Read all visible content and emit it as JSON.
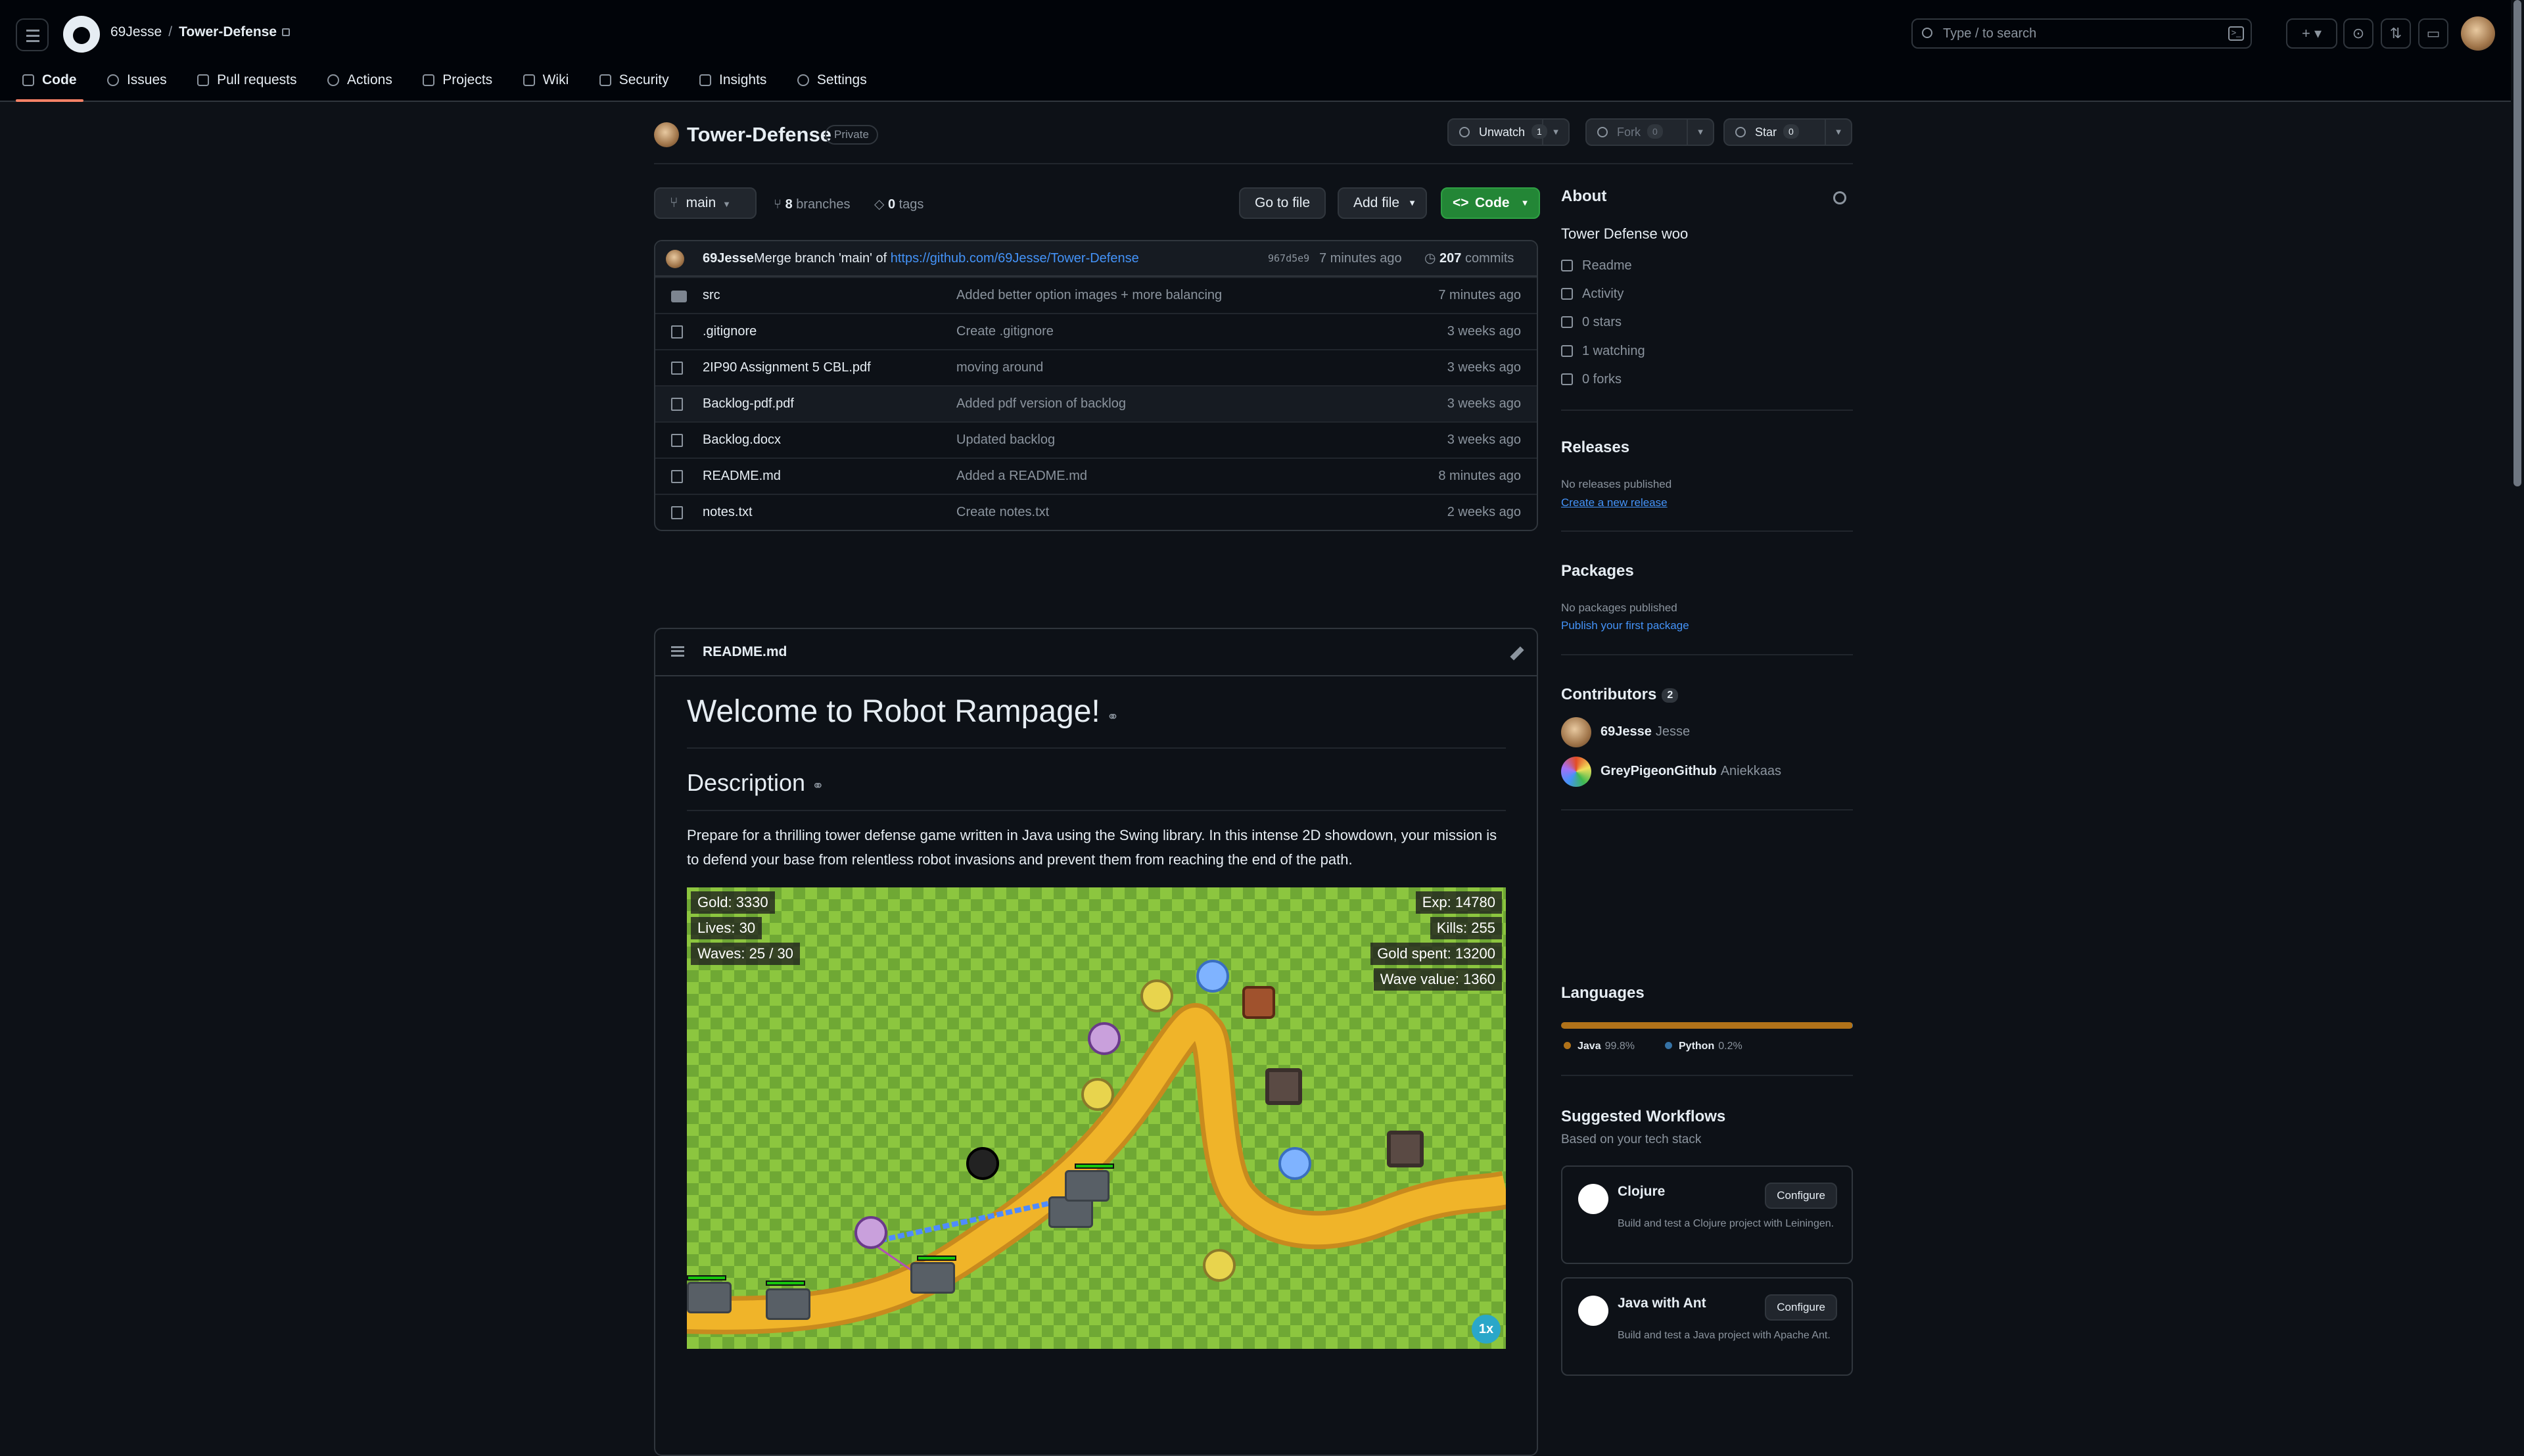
{
  "header": {
    "owner": "69Jesse",
    "repo": "Tower-Defense",
    "search_placeholder": "Type / to search",
    "command_glyph": ">_",
    "plus_glyph": "+ ▾",
    "issues_glyph": "⊙",
    "pulls_glyph": "⇅",
    "inbox_glyph": "▭"
  },
  "tabs": [
    {
      "label": "Code",
      "icon": "code-icon"
    },
    {
      "label": "Issues",
      "icon": "issues-icon"
    },
    {
      "label": "Pull requests",
      "icon": "pull-request-icon"
    },
    {
      "label": "Actions",
      "icon": "actions-icon"
    },
    {
      "label": "Projects",
      "icon": "projects-icon"
    },
    {
      "label": "Wiki",
      "icon": "wiki-icon"
    },
    {
      "label": "Security",
      "icon": "shield-icon"
    },
    {
      "label": "Insights",
      "icon": "graph-icon"
    },
    {
      "label": "Settings",
      "icon": "gear-icon"
    }
  ],
  "repo": {
    "name": "Tower-Defense",
    "visibility": "Private",
    "unwatch_label": "Unwatch",
    "watch_count": "1",
    "fork_label": "Fork",
    "fork_count": "0",
    "star_label": "Star",
    "star_count": "0"
  },
  "toolbar": {
    "branch": "main",
    "branches_count": "8",
    "branches_label": "branches",
    "tags_count": "0",
    "tags_label": "tags",
    "go_to_file": "Go to file",
    "add_file": "Add file",
    "code": "Code"
  },
  "commit": {
    "author": "69Jesse",
    "message": "Merge branch 'main' of",
    "url": "https://github.com/69Jesse/Tower-Defense",
    "sha": "967d5e9",
    "ago": "7 minutes ago",
    "commits_count": "207",
    "commits_label": "commits"
  },
  "files": [
    {
      "name": "src",
      "type": "dir",
      "message": "Added better option images + more balancing",
      "age": "7 minutes ago"
    },
    {
      "name": ".gitignore",
      "type": "file",
      "message": "Create .gitignore",
      "age": "3 weeks ago"
    },
    {
      "name": "2IP90 Assignment 5 CBL.pdf",
      "type": "file",
      "message": "moving around",
      "age": "3 weeks ago"
    },
    {
      "name": "Backlog-pdf.pdf",
      "type": "file",
      "message": "Added pdf version of backlog",
      "age": "3 weeks ago"
    },
    {
      "name": "Backlog.docx",
      "type": "file",
      "message": "Updated backlog",
      "age": "3 weeks ago"
    },
    {
      "name": "README.md",
      "type": "file",
      "message": "Added a README.md",
      "age": "8 minutes ago"
    },
    {
      "name": "notes.txt",
      "type": "file",
      "message": "Create notes.txt",
      "age": "2 weeks ago"
    }
  ],
  "readme": {
    "filename": "README.md",
    "title": "Welcome to Robot Rampage!",
    "section": "Description",
    "paragraph": "Prepare for a thrilling tower defense game written in Java using the Swing library. In this intense 2D showdown, your mission is to defend your base from relentless robot invasions and prevent them from reaching the end of the path.",
    "game": {
      "gold": "Gold: 3330",
      "lives": "Lives: 30",
      "waves": "Waves: 25 / 30",
      "exp": "Exp: 14780",
      "kills": "Kills: 255",
      "gold_spent": "Gold spent: 13200",
      "wave_value": "Wave value: 1360",
      "speed": "1x"
    }
  },
  "about": {
    "title": "About",
    "description": "Tower Defense woo",
    "readme": "Readme",
    "activity": "Activity",
    "stars": "0 stars",
    "watching": "1 watching",
    "forks": "0 forks"
  },
  "releases": {
    "title": "Releases",
    "empty": "No releases published",
    "link": "Create a new release"
  },
  "packages": {
    "title": "Packages",
    "empty": "No packages published",
    "link": "Publish your first package"
  },
  "contributors": {
    "title": "Contributors",
    "count": "2",
    "list": [
      {
        "login": "69Jesse",
        "name": "Jesse"
      },
      {
        "login": "GreyPigeonGithub",
        "name": "Aniekkaas"
      }
    ]
  },
  "languages": {
    "title": "Languages",
    "items": [
      {
        "name": "Java",
        "percent": "99.8%",
        "color": "#b07219"
      },
      {
        "name": "Python",
        "percent": "0.2%",
        "color": "#3572a5"
      }
    ]
  },
  "workflows": {
    "title": "Suggested Workflows",
    "subtitle": "Based on your tech stack",
    "configure_label": "Configure",
    "items": [
      {
        "name": "Clojure",
        "description": "Build and test a Clojure project with Leiningen."
      },
      {
        "name": "Java with Ant",
        "description": "Build and test a Java project with Apache Ant."
      }
    ]
  },
  "colors": {
    "accent": "#f78166",
    "link": "#4493f8",
    "green": "#238636",
    "bg": "#0d1117"
  }
}
